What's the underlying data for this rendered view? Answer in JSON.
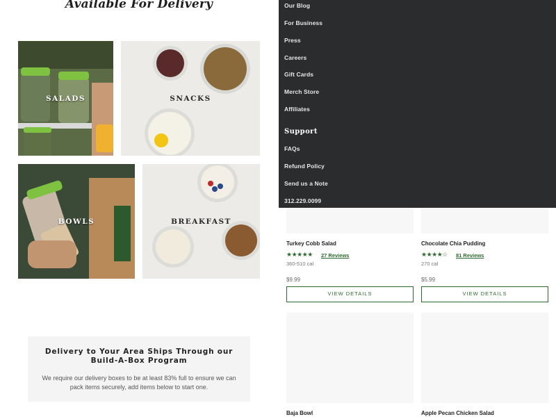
{
  "delivery": {
    "heading": "Available For Delivery",
    "categories": [
      {
        "label": "SALADS"
      },
      {
        "label": "SNACKS"
      },
      {
        "label": "BOWLS"
      },
      {
        "label": "BREAKFAST"
      }
    ],
    "notice": {
      "title": "Delivery to Your Area Ships Through our Build-A-Box Program",
      "body": "We require our delivery boxes to be at least 83% full to ensure we can pack items securely, add items below to start one."
    }
  },
  "menu": {
    "items": [
      {
        "label": "Our Blog"
      },
      {
        "label": "For Business"
      },
      {
        "label": "Press"
      },
      {
        "label": "Careers"
      },
      {
        "label": "Gift Cards"
      },
      {
        "label": "Merch Store"
      },
      {
        "label": "Affiliates"
      }
    ],
    "support_heading": "Support",
    "support_items": [
      {
        "label": "FAQs"
      },
      {
        "label": "Refund Policy"
      },
      {
        "label": "Send us a Note"
      },
      {
        "label": "312.229.0099"
      }
    ]
  },
  "products": [
    {
      "name": "Turkey Cobb Salad",
      "rating": 5,
      "stars": "★★★★★",
      "reviews": "27 Reviews",
      "calories": "360-510 cal",
      "price": "$9.99",
      "button": "VIEW DETAILS"
    },
    {
      "name": "Chocolate Chia Pudding",
      "rating": 4,
      "stars": "★★★★",
      "empty_stars": "☆",
      "reviews": "81 Reviews",
      "calories": "270 cal",
      "price": "$5.99",
      "button": "VIEW DETAILS"
    },
    {
      "name": "Baja Bowl"
    },
    {
      "name": "Apple Pecan Chicken Salad"
    }
  ],
  "colors": {
    "brand_green": "#2d6a2d",
    "menu_bg": "#2b2c2e",
    "card_bg": "#f7f7f7"
  }
}
